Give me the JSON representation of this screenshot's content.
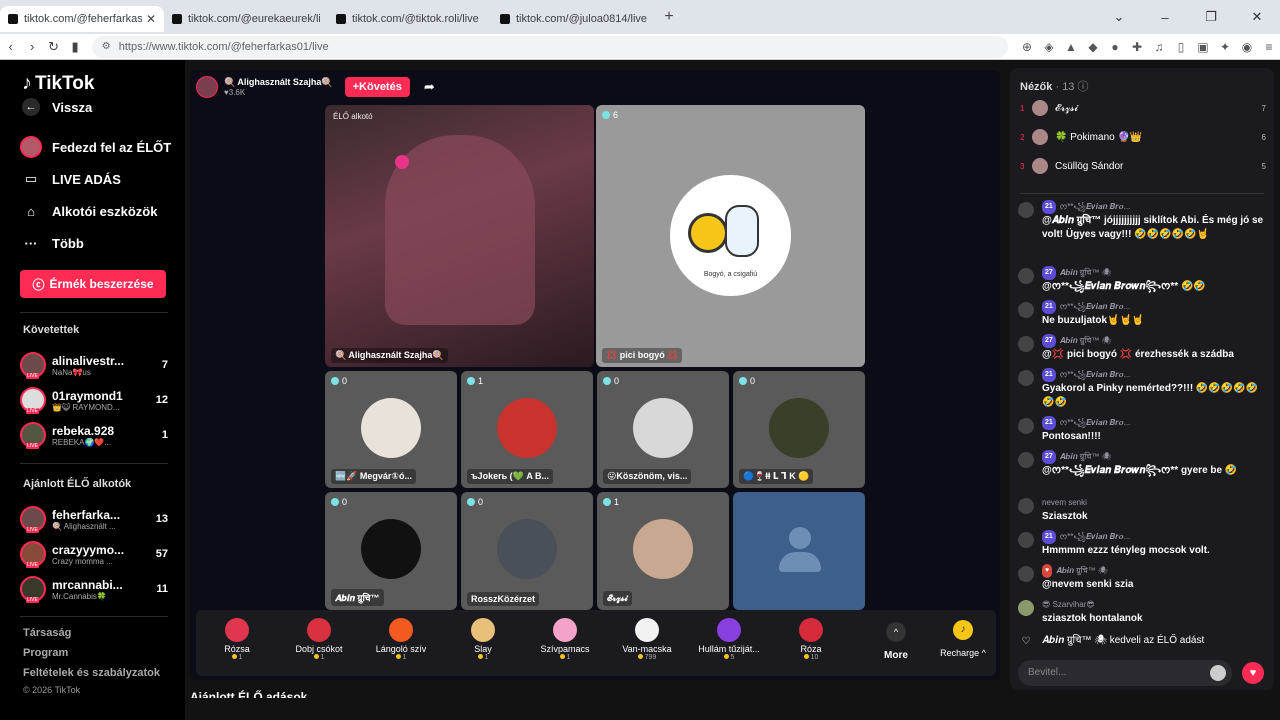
{
  "browser": {
    "tabs": [
      {
        "title": "tiktok.com/@feherfarkas01/live",
        "active": true
      },
      {
        "title": "tiktok.com/@eurekaeurek/live",
        "active": false
      },
      {
        "title": "tiktok.com/@tiktok.roli/live",
        "active": false
      },
      {
        "title": "tiktok.com/@juloa0814/live",
        "active": false
      }
    ],
    "url": "https://www.tiktok.com/@feherfarkas01/live",
    "new_tab": "+"
  },
  "sidebar": {
    "logo": "TikTok",
    "back": "Vissza",
    "nav": [
      "Fedezd fel az ÉLŐT",
      "LIVE ADÁS",
      "Alkotói eszközök",
      "Több"
    ],
    "coins_button": "Érmék beszerzése",
    "following_title": "Követettek",
    "following": [
      {
        "name": "alinalivestr...",
        "sub": "NaNa🎀us",
        "count": "7"
      },
      {
        "name": "01raymond1",
        "sub": "👑😺 RAYMOND...",
        "count": "12"
      },
      {
        "name": "rebeka.928",
        "sub": "REBEKA🌍❤️...",
        "count": "1"
      }
    ],
    "recommended_title": "Ajánlott ÉLŐ alkotók",
    "recommended": [
      {
        "name": "feherfarka...",
        "sub": "🍭 Alighasznált ...",
        "count": "13"
      },
      {
        "name": "crazyyymo...",
        "sub": "Crazy momma ...",
        "count": "57"
      },
      {
        "name": "mrcannabi...",
        "sub": "Mr.Cannabis🍀",
        "count": "11"
      }
    ],
    "live_badge": "LIVE",
    "footer": [
      "Társaság",
      "Program",
      "Feltételek és szabályzatok",
      "© 2026 TikTok"
    ]
  },
  "stream": {
    "host_name": "🍭 Alighasznált Szajha🍭",
    "host_likes": "♥3.6K",
    "follow_label": "+Követés",
    "host_tile_label": "ÉLŐ alkotó",
    "host_tile_name": "🍭 Alighasznált Szajha🍭",
    "guest_tile": {
      "viewers": "6",
      "name": "💢 pici bogyó 💢",
      "caption": "Bogyó, a csigafiú"
    },
    "small_tiles": [
      {
        "viewers": "0",
        "name": "🆕🚀 Megvár①ó..."
      },
      {
        "viewers": "1",
        "name": "ъJokerь (💚 A B..."
      },
      {
        "viewers": "0",
        "name": "😛Köszönöm, vis..."
      },
      {
        "viewers": "0",
        "name": "🔵🍷ⱡⱡ ᒪ ᒣ K 🟡"
      },
      {
        "viewers": "0",
        "name": "𝑨𝒃𝒊𝒏 ग्रुचि™"
      },
      {
        "viewers": "0",
        "name": "RosszKözérzet"
      },
      {
        "viewers": "1",
        "name": "𝓔𝓻𝔃𝓼𝓲"
      },
      {
        "viewers": "",
        "name": ""
      }
    ]
  },
  "gifts": [
    {
      "name": "Rózsa",
      "price": "1",
      "color": "#e0364e"
    },
    {
      "name": "Dobj csókot",
      "price": "1",
      "color": "#d8313f"
    },
    {
      "name": "Lángoló szív",
      "price": "1",
      "color": "#f25a1f"
    },
    {
      "name": "Slay",
      "price": "1",
      "color": "#e8c07a"
    },
    {
      "name": "Szívpamacs",
      "price": "1",
      "color": "#f3a2c8"
    },
    {
      "name": "Van-macska",
      "price": "799",
      "color": "#f2f2f2"
    },
    {
      "name": "Hullám tűziját...",
      "price": "5",
      "color": "#8a3fe0"
    },
    {
      "name": "Róza",
      "price": "10",
      "color": "#d62b3c"
    }
  ],
  "more_label": "More",
  "recharge_label": "Recharge ^",
  "recommended_live": "Ajánlott ÉLŐ adások",
  "chat": {
    "viewers_label": "Nézők",
    "viewers_count": "· 13",
    "ranking": [
      {
        "rank": "1",
        "name": "𝓔𝓻𝔃𝓼𝓲",
        "score": "7"
      },
      {
        "rank": "2",
        "name": "🍀 Pokimano 🔮👑",
        "score": "6"
      },
      {
        "rank": "3",
        "name": "Csüllög Sándor",
        "score": "5"
      }
    ],
    "messages": [
      {
        "badge": "21",
        "hb": "",
        "user": "ᰔ**꧁𝑬𝒗𝒊𝒂𝒏 𝑩𝒓𝒐...",
        "text": "@𝑨𝒃𝒊𝒏 ग्रुचि™ jójjjjjjjjjj siklítok Abi. És még jó se volt! Ügyes vagy!!! 🤣🤣🤣🤣🤣🤘"
      },
      {
        "badge": "27",
        "hb": "",
        "user": "𝑨𝒃𝒊𝒏 ग्रुचि™ 🕷",
        "text": "@ᰔ**꧁𝑬𝒗𝒊𝒂𝒏 𝑩𝒓𝒐𝒘𝒏꧂ᰔ** 🤣🤣"
      },
      {
        "badge": "21",
        "hb": "",
        "user": "ᰔ**꧁𝑬𝒗𝒊𝒂𝒏 𝑩𝒓𝒐...",
        "text": "Ne buzuljatok🤘🤘🤘"
      },
      {
        "badge": "27",
        "hb": "",
        "user": "𝑨𝒃𝒊𝒏 ग्रुचि™ 🕷",
        "text": "@💢 pici bogyó 💢 érezhessék a szádba"
      },
      {
        "badge": "21",
        "hb": "",
        "user": "ᰔ**꧁𝑬𝒗𝒊𝒂𝒏 𝑩𝒓𝒐...",
        "text": "Gyakorol a Pinky nemérted??!!! 🤣🤣🤣🤣🤣🤣🤣"
      },
      {
        "badge": "21",
        "hb": "",
        "user": "ᰔ**꧁𝑬𝒗𝒊𝒂𝒏 𝑩𝒓𝒐...",
        "text": "Pontosan!!!!"
      },
      {
        "badge": "27",
        "hb": "",
        "user": "𝑨𝒃𝒊𝒏 ग्रुचि™ 🕷",
        "text": "@ᰔ**꧁𝑬𝒗𝒊𝒂𝒏 𝑩𝒓𝒐𝒘𝒏꧂ᰔ** gyere be 🤣"
      },
      {
        "badge": "",
        "hb": "",
        "user": "nevem senki",
        "text": "Sziasztok"
      },
      {
        "badge": "21",
        "hb": "",
        "user": "ᰔ**꧁𝑬𝒗𝒊𝒂𝒏 𝑩𝒓𝒐...",
        "text": "Hmmmm ezzz tényleg mocsok volt."
      },
      {
        "badge": "",
        "hb": "",
        "user": "𝑨𝒃𝒊𝒏 ग्रुचि™ 🕷",
        "text": "@nevem senki szia"
      },
      {
        "badge": "",
        "hb": "",
        "user": "😎 Szarvihar😎",
        "text": "sziasztok hontalanok"
      },
      {
        "badge": "",
        "hb": "",
        "user": "",
        "text": "𝑨𝒃𝒊𝒏 ग्रुचि™ 🕷 kedveli az ÉLŐ adást"
      }
    ],
    "input_placeholder": "Bevitel..."
  }
}
